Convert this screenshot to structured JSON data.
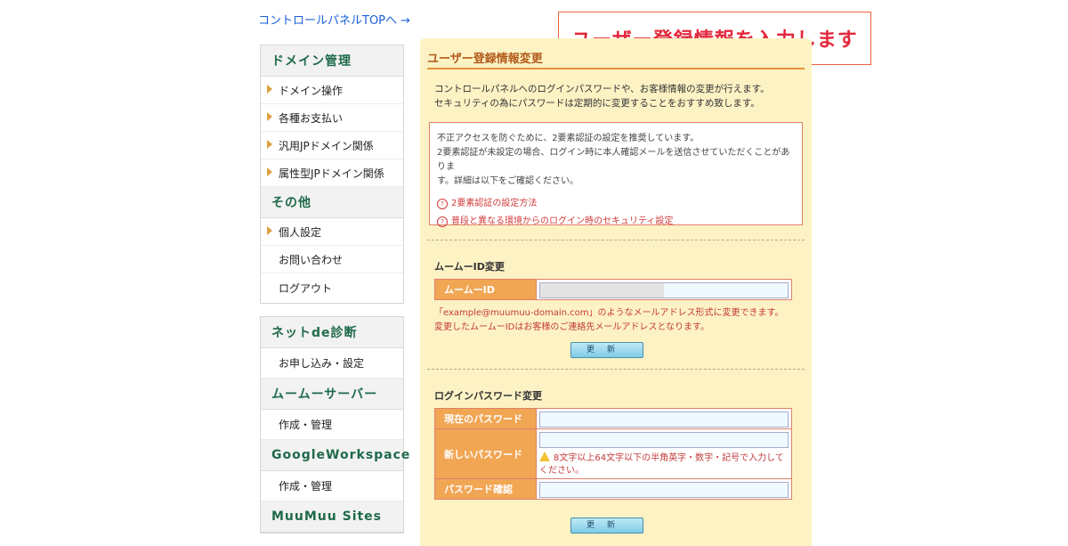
{
  "top_link": {
    "label": "コントロールパネルTOPへ",
    "arrow": "→"
  },
  "callout": "ユーザー登録情報を入力します",
  "sidebar": {
    "groups": [
      {
        "title": "ドメイン管理",
        "items": [
          "ドメイン操作",
          "各種お支払い",
          "汎用JPドメイン関係",
          "属性型JPドメイン関係"
        ]
      },
      {
        "title": "その他",
        "items": [
          "個人設定",
          "お問い合わせ",
          "ログアウト"
        ]
      },
      {
        "title": "ネットde診断",
        "items": [
          "お申し込み・設定"
        ]
      },
      {
        "title": "ムームーサーバー",
        "items": [
          "作成・管理"
        ]
      },
      {
        "title": "GoogleWorkspace",
        "items": [
          "作成・管理"
        ]
      },
      {
        "title": "MuuMuu Sites",
        "items": []
      }
    ]
  },
  "panel": {
    "title": "ユーザー登録情報変更",
    "intro": [
      "コントロールパネルへのログインパスワードや、お客様情報の変更が行えます。",
      "セキュリティの為にパスワードは定期的に変更することをおすすめ致します。"
    ],
    "notice": {
      "lines": [
        "不正アクセスを防ぐために、2要素認証の設定を推奨しています。",
        "2要素認証が未設定の場合、ログイン時に本人確認メールを送信させていただくことがありま",
        "す。詳細は以下をご確認ください。"
      ],
      "links": [
        "2要素認証の設定方法",
        "普段と異なる環境からのログイン時のセキュリティ設定"
      ],
      "link_icon": "?"
    },
    "id_section": {
      "title": "ムームーID変更",
      "label": "ムームーID",
      "desc": [
        "「example@muumuu-domain.com」のようなメールアドレス形式に変更できます。",
        "変更したムームーIDはお客様のご連絡先メールアドレスとなります。"
      ],
      "button": "更新"
    },
    "pw_section": {
      "title": "ログインパスワード変更",
      "current_label": "現在のパスワード",
      "new_label": "新しいパスワード",
      "confirm_label": "パスワード確認",
      "hint": "8文字以上64文字以下の半角英字・数字・記号で入力してください。",
      "button": "更新"
    }
  },
  "colors": {
    "accent": "#e4283b",
    "sidebar_title": "#1f6a4a",
    "label_bg": "#f1a654",
    "panel_bg": "#fdf2c4"
  }
}
